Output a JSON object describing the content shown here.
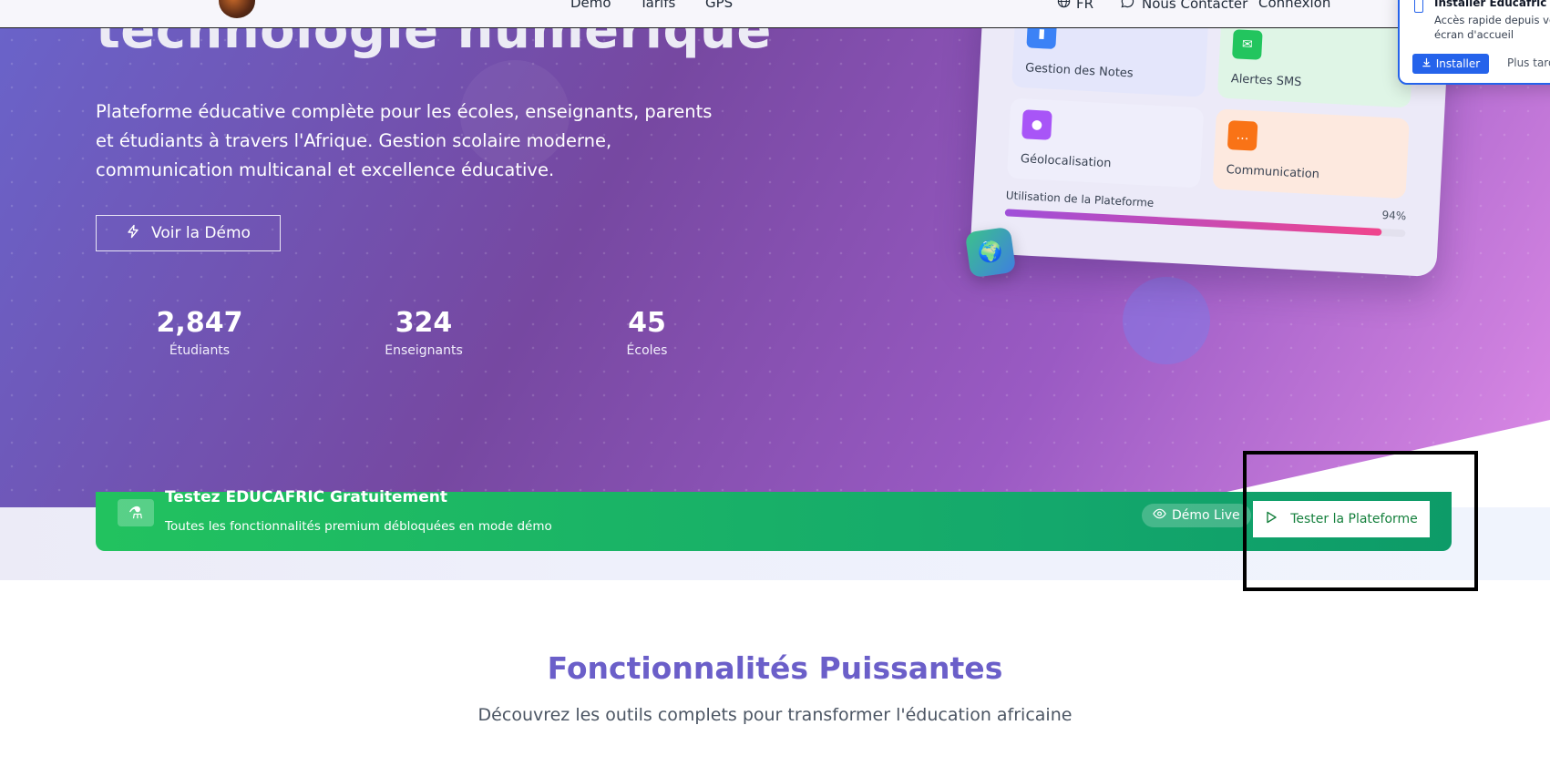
{
  "nav": {
    "links": [
      "Démo",
      "Tarifs",
      "GPS"
    ],
    "lang": "FR",
    "contact": "Nous Contacter",
    "login": "Connexion"
  },
  "hero": {
    "title": "technologie numérique",
    "description": "Plateforme éducative complète pour les écoles, enseignants, parents et étudiants à travers l'Afrique. Gestion scolaire moderne, communication multicanal et excellence éducative.",
    "demo_button": "Voir la Démo",
    "stats": [
      {
        "value": "2,847",
        "label": "Étudiants"
      },
      {
        "value": "324",
        "label": "Enseignants"
      },
      {
        "value": "45",
        "label": "Écoles"
      }
    ]
  },
  "dashboard": {
    "cards": [
      {
        "label": "Gestion des Notes",
        "icon": "chart-icon",
        "color": "#3b82f6"
      },
      {
        "label": "Alertes SMS",
        "icon": "sms-icon",
        "color": "#22c55e"
      },
      {
        "label": "Géolocalisation",
        "icon": "map-pin-icon",
        "color": "#a855f7"
      },
      {
        "label": "Communication",
        "icon": "chat-icon",
        "color": "#f97316"
      }
    ],
    "usage_label": "Utilisation de la Plateforme",
    "usage_percent": "94%",
    "usage_value": 0.94
  },
  "banner": {
    "title": "Testez EDUCAFRIC Gratuitement",
    "subtitle": "Toutes les fonctionnalités premium débloquées en mode démo",
    "demo_live": "Démo Live",
    "cta": "Tester la Plateforme"
  },
  "features": {
    "title": "Fonctionnalités Puissantes",
    "subtitle": "Découvrez les outils complets pour transformer l'éducation africaine"
  },
  "install_popup": {
    "title": "Installer Educafric",
    "description": "Accès rapide depuis votre écran d'accueil",
    "install_button": "Installer",
    "later_button": "Plus tard"
  }
}
